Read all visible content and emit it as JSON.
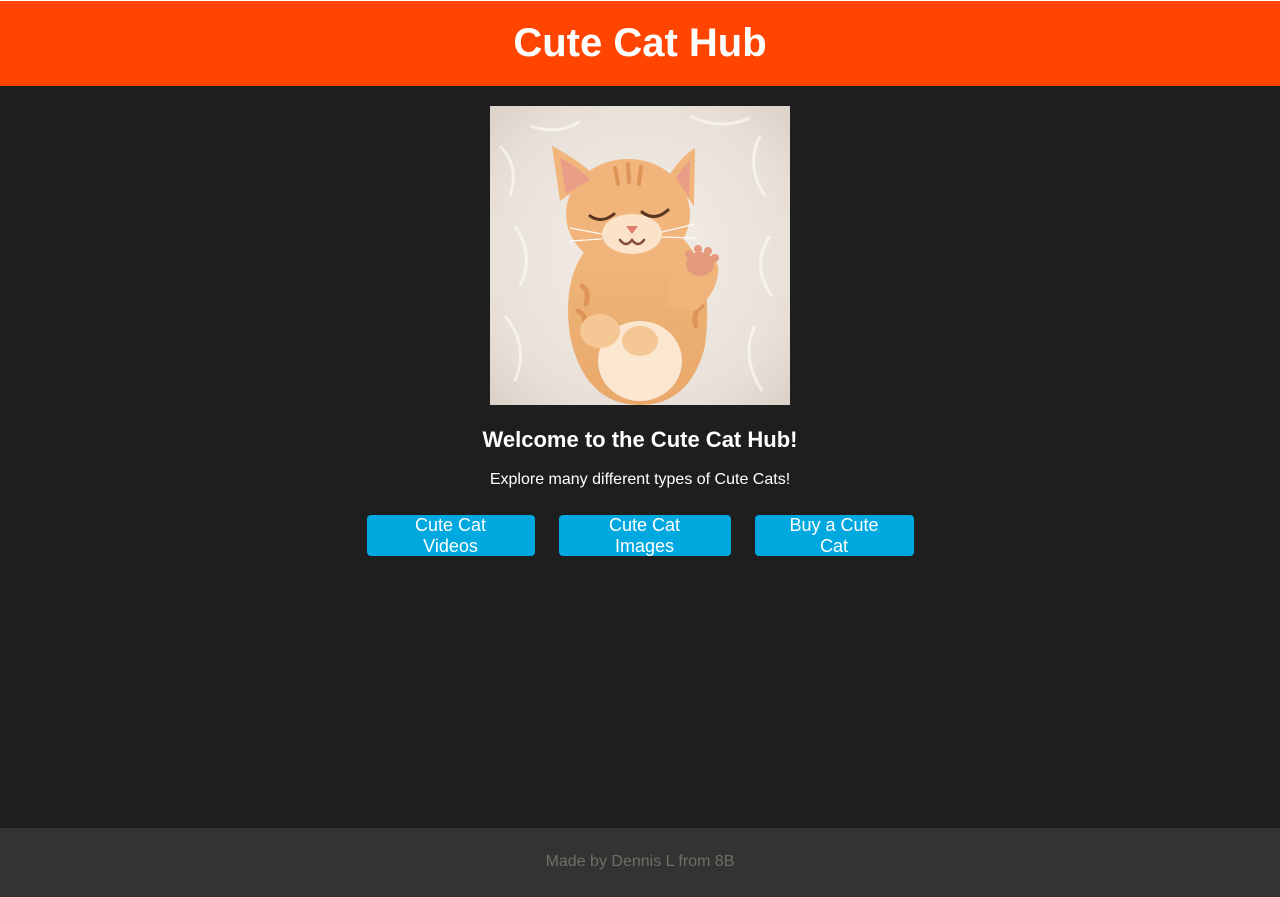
{
  "header": {
    "title": "Cute Cat Hub"
  },
  "hero": {
    "image_icon": "sleeping-kitten-photo",
    "heading": "Welcome to the Cute Cat Hub!",
    "tagline": "Explore many different types of Cute Cats!"
  },
  "buttons": [
    {
      "label": "Cute Cat Videos"
    },
    {
      "label": "Cute Cat Images"
    },
    {
      "label": "Buy a Cute Cat"
    }
  ],
  "footer": {
    "text": "Made by Dennis L from 8B"
  },
  "colors": {
    "header_bg": "#ff4500",
    "page_bg": "#1e1e1e",
    "button_bg": "#00a8e0",
    "footer_bg": "#333333",
    "footer_text": "#6e6e62"
  }
}
